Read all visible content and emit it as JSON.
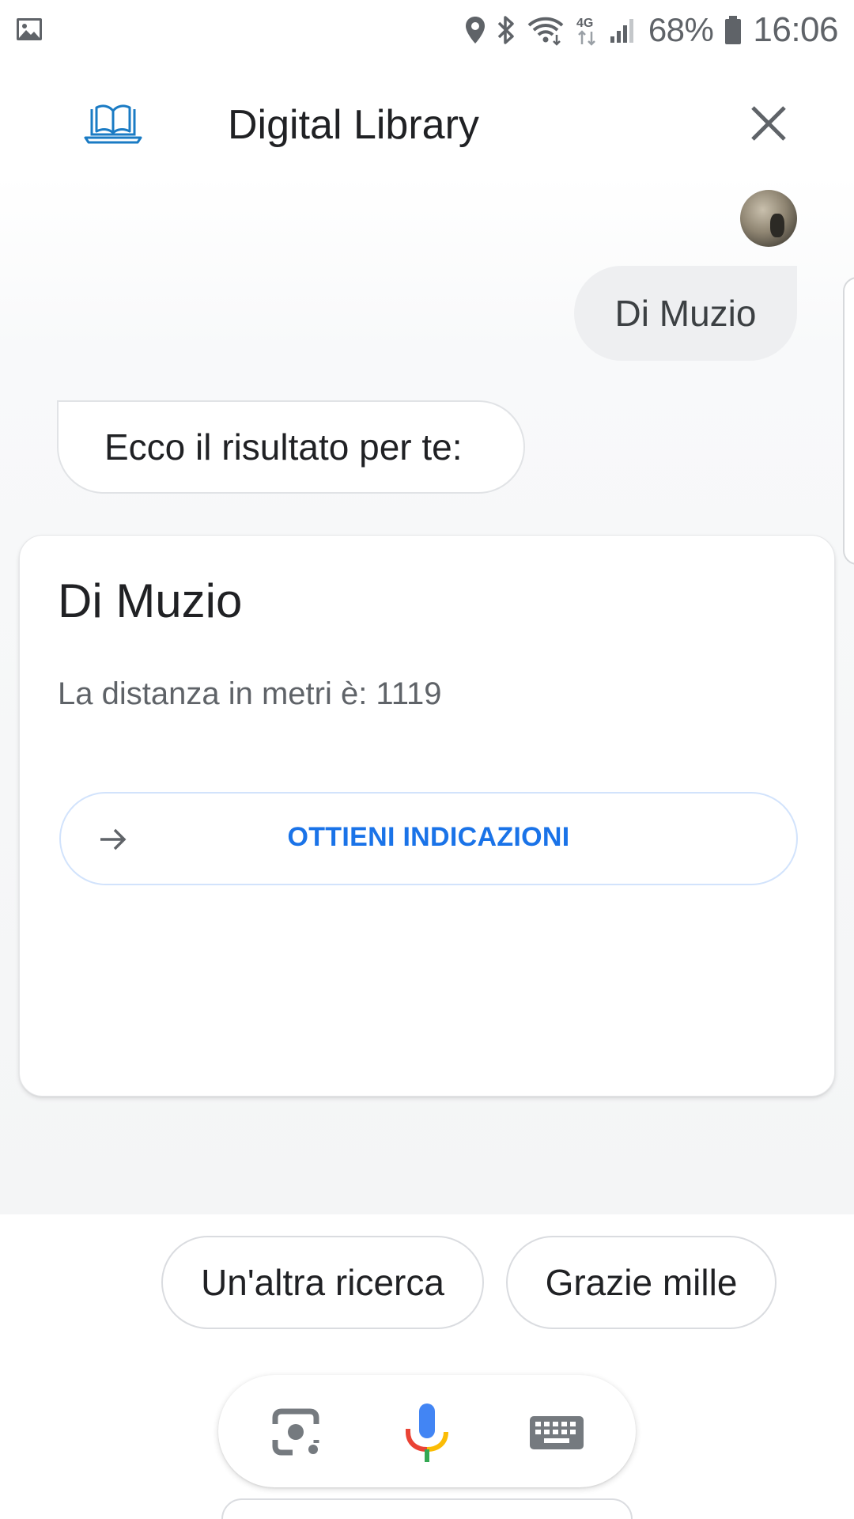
{
  "status_bar": {
    "battery_percent": "68%",
    "time": "16:06",
    "network_type": "4G",
    "icons": [
      "gallery-icon",
      "location-icon",
      "bluetooth-icon",
      "wifi-icon",
      "4g-icon",
      "signal-icon",
      "battery-icon"
    ]
  },
  "header": {
    "title": "Digital Library",
    "logo_icon": "laptop-book-icon",
    "close_icon": "close-icon"
  },
  "conversation": {
    "user_message": "Di Muzio",
    "bot_message": "Ecco il risultato per te:",
    "card": {
      "title": "Di Muzio",
      "text": "La distanza in metri è: 1119",
      "action_label": "OTTIENI INDICAZIONI",
      "action_icon": "arrow-right-icon"
    }
  },
  "suggestions": [
    "Un'altra ricerca",
    "Grazie mille"
  ],
  "input_bar": {
    "icons": [
      "lens-icon",
      "microphone-icon",
      "keyboard-icon"
    ]
  },
  "colors": {
    "accent": "#1a73e8",
    "logo": "#1a7bc4",
    "text": "#202124",
    "secondary_text": "#5f6368",
    "user_bubble": "#eeeff1"
  }
}
